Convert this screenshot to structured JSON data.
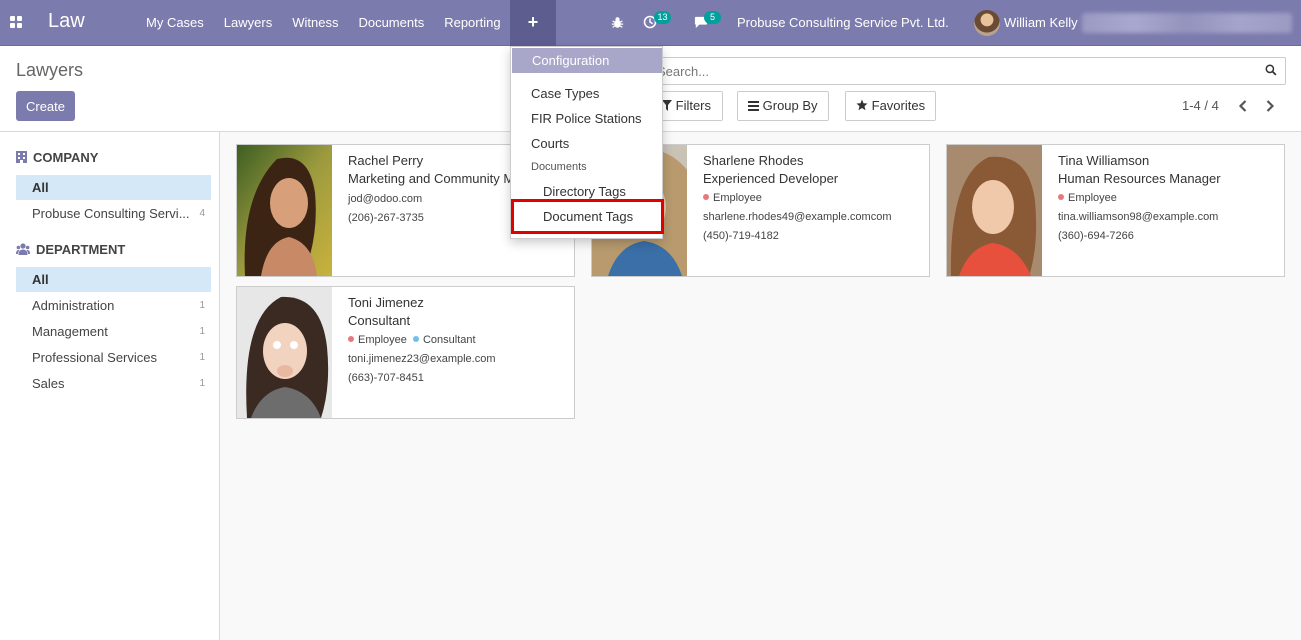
{
  "app": {
    "brand": "Law"
  },
  "navbar": {
    "menus": [
      "My Cases",
      "Lawyers",
      "Witness",
      "Documents",
      "Reporting"
    ],
    "plus_label": "+",
    "activity_badge": "13",
    "message_badge": "5",
    "company": "Probuse Consulting Service Pvt. Ltd.",
    "user": "William Kelly"
  },
  "control_panel": {
    "breadcrumb": "Lawyers",
    "create_label": "Create",
    "search_placeholder": "Search...",
    "filters_label": "Filters",
    "groupby_label": "Group By",
    "favorites_label": "Favorites",
    "pager": "1-4 / 4"
  },
  "dropdown": {
    "header": "Configuration",
    "items": [
      "Case Types",
      "FIR Police Stations",
      "Courts"
    ],
    "section": "Documents",
    "sub_items": [
      "Directory Tags",
      "Document Tags"
    ]
  },
  "side_panel": {
    "company_header": "COMPANY",
    "company_items": [
      {
        "label": "All",
        "count": ""
      },
      {
        "label": "Probuse Consulting Servi...",
        "count": "4"
      }
    ],
    "department_header": "DEPARTMENT",
    "department_items": [
      {
        "label": "All",
        "count": ""
      },
      {
        "label": "Administration",
        "count": "1"
      },
      {
        "label": "Management",
        "count": "1"
      },
      {
        "label": "Professional Services",
        "count": "1"
      },
      {
        "label": "Sales",
        "count": "1"
      }
    ]
  },
  "cards": [
    {
      "name": "Rachel Perry",
      "job": "Marketing and Community Manager",
      "tags": [],
      "email": "jod@odoo.com",
      "phone": "(206)-267-3735"
    },
    {
      "name": "Sharlene Rhodes",
      "job": "Experienced Developer",
      "tags": [
        "Employee"
      ],
      "email": "sharlene.rhodes49@example.comcom",
      "phone": "(450)-719-4182"
    },
    {
      "name": "Tina Williamson",
      "job": "Human Resources Manager",
      "tags": [
        "Employee"
      ],
      "email": "tina.williamson98@example.com",
      "phone": "(360)-694-7266"
    },
    {
      "name": "Toni Jimenez",
      "job": "Consultant",
      "tags": [
        "Employee",
        "Consultant"
      ],
      "email": "toni.jimenez23@example.com",
      "phone": "(663)-707-8451"
    }
  ],
  "colors": {
    "brand": "#7c7bad",
    "active_menu": "#5e5d8f",
    "badge": "#00a09d",
    "highlight": "#e00000",
    "tag_employee": "#e8787e",
    "tag_consultant": "#6cc1ed"
  }
}
